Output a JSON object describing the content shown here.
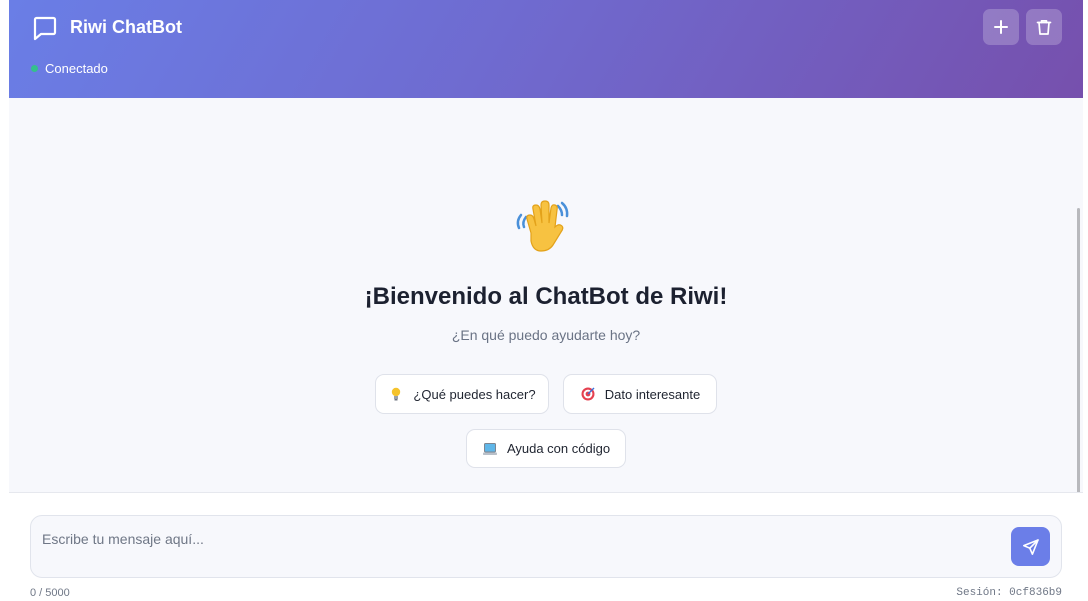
{
  "header": {
    "title": "Riwi ChatBot",
    "status": "Conectado",
    "brand_icon": "chat-bubble-icon",
    "new_icon": "plus-icon",
    "delete_icon": "trash-icon",
    "gradient_start": "#6a7ee6",
    "gradient_end": "#7650ad",
    "status_color": "#34c08c"
  },
  "welcome": {
    "emoji": "waving-hand",
    "title": "¡Bienvenido al ChatBot de Riwi!",
    "subtitle": "¿En qué puedo ayudarte hoy?"
  },
  "suggestions": [
    {
      "label": "¿Qué puedes hacer?",
      "icon": "lightbulb-icon"
    },
    {
      "label": "Dato interesante",
      "icon": "target-icon"
    },
    {
      "label": "Ayuda con código",
      "icon": "laptop-icon"
    }
  ],
  "composer": {
    "placeholder": "Escribe tu mensaje aquí...",
    "value": "",
    "char_count": "0 / 5000",
    "session": "Sesión: 0cf836b9",
    "send_icon": "send-icon",
    "accent": "#6b7ee8"
  }
}
